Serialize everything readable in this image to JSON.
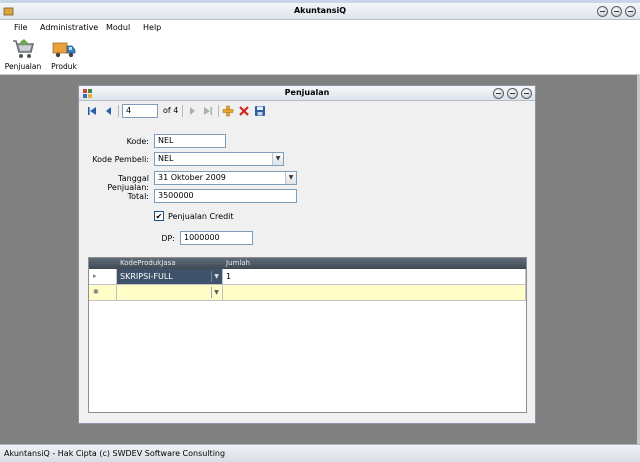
{
  "app": {
    "title": "AkuntansiQ",
    "colors": {
      "mdi_background": "#808080",
      "grid_new_row": "#fffdc8",
      "grid_selected_cell": "#3e5369"
    }
  },
  "menu": {
    "file": "File",
    "administrative": "Administrative",
    "modul": "Modul",
    "help": "Help"
  },
  "toolbar": {
    "penjualan": "Penjualan",
    "produk": "Produk"
  },
  "status": {
    "text": "AkuntansiQ - Hak Cipta (c) SWDEV Software Consulting"
  },
  "form": {
    "title": "Penjualan",
    "navigator": {
      "position": "4",
      "of_label": "of 4"
    },
    "kode": {
      "label": "Kode:",
      "value": "NEL"
    },
    "kode_pembeli": {
      "label": "Kode Pembeli:",
      "value": "NEL"
    },
    "tanggal": {
      "label": "Tanggal Penjualan:",
      "value": "31   Oktober   2009"
    },
    "total": {
      "label": "Total:",
      "value": "3500000"
    },
    "credit": {
      "label": "Penjualan Credit",
      "checked": true,
      "mark": "✔"
    },
    "dp": {
      "label": "DP:",
      "value": "1000000"
    }
  },
  "grid": {
    "columns": [
      "KodeProdukJasa",
      "Jumlah"
    ],
    "rows": [
      {
        "indicator": "▸",
        "kode": "SKRIPSI-FULL",
        "jumlah": "1"
      },
      {
        "indicator": "✱",
        "kode": "",
        "jumlah": ""
      }
    ]
  }
}
